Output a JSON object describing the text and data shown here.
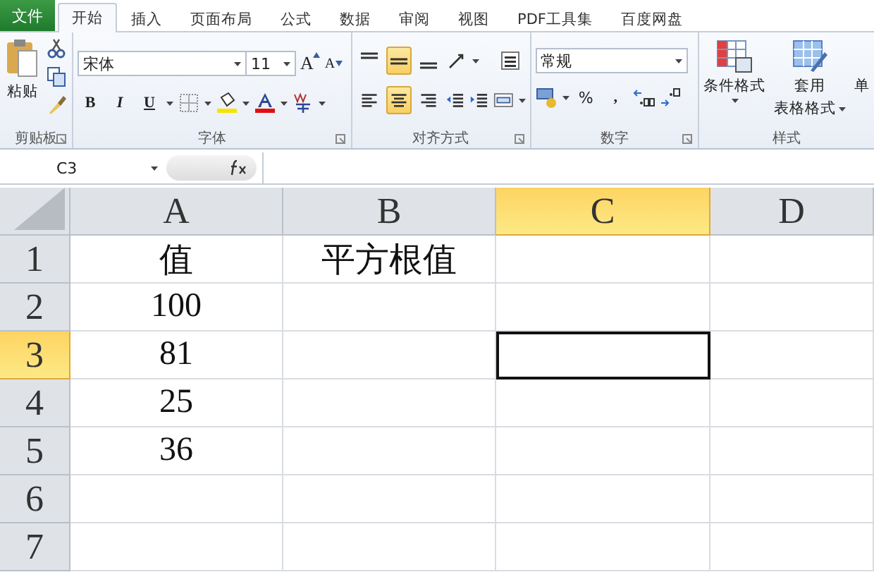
{
  "file_button": "文件",
  "tabs": [
    {
      "label": "开始",
      "selected": true
    },
    {
      "label": "插入",
      "selected": false
    },
    {
      "label": "页面布局",
      "selected": false
    },
    {
      "label": "公式",
      "selected": false
    },
    {
      "label": "数据",
      "selected": false
    },
    {
      "label": "审阅",
      "selected": false
    },
    {
      "label": "视图",
      "selected": false
    },
    {
      "label": "PDF工具集",
      "selected": false
    },
    {
      "label": "百度网盘",
      "selected": false
    }
  ],
  "clipboard": {
    "paste": "粘贴",
    "label": "剪贴板"
  },
  "font": {
    "name": "宋体",
    "size": "11",
    "grow": "A",
    "shrink": "A",
    "bold": "B",
    "italic": "I",
    "underline": "U",
    "label": "字体"
  },
  "alignment": {
    "vertical": [
      {
        "selected": false
      },
      {
        "selected": true
      },
      {
        "selected": false
      }
    ],
    "horizontal": [
      {
        "selected": false
      },
      {
        "selected": true
      },
      {
        "selected": false
      }
    ],
    "label": "对齐方式"
  },
  "number": {
    "format": "常规",
    "percent": "%",
    "comma": ",",
    "label": "数字"
  },
  "styles": {
    "conditional": "条件格式",
    "table_format_1": "套用",
    "table_format_2": "表格格式",
    "cell_styles": "单",
    "label": "样式"
  },
  "name_box": "C3",
  "columns": [
    {
      "label": "A",
      "selected": false
    },
    {
      "label": "B",
      "selected": false
    },
    {
      "label": "C",
      "selected": true
    },
    {
      "label": "D",
      "selected": false
    }
  ],
  "rows": [
    {
      "header": "1",
      "selected": false,
      "cells": [
        "值",
        "平方根值"
      ]
    },
    {
      "header": "2",
      "selected": false,
      "cells": [
        "100"
      ]
    },
    {
      "header": "3",
      "selected": true,
      "cells": [
        "81"
      ]
    },
    {
      "header": "4",
      "selected": false,
      "cells": [
        "25"
      ]
    },
    {
      "header": "5",
      "selected": false,
      "cells": [
        "36"
      ]
    },
    {
      "header": "6",
      "selected": false,
      "cells": []
    },
    {
      "header": "7",
      "selected": false,
      "cells": []
    }
  ]
}
